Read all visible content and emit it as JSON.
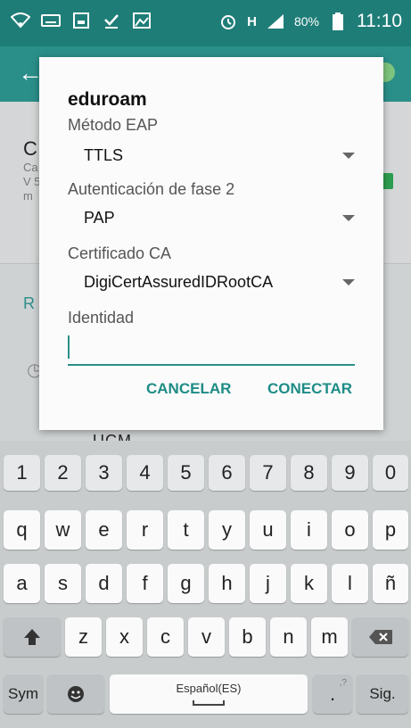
{
  "status_bar": {
    "icons_left": [
      "wifi-icon",
      "keyboard-icon",
      "screenshot-icon",
      "download-done-icon",
      "image-icon"
    ],
    "alarm_icon": "alarm-icon",
    "network_type": "H",
    "battery": "80%",
    "time": "11:10"
  },
  "background": {
    "section_letter": "C",
    "section_text": "Ca y V 5 m",
    "list_header": "R",
    "network_name": "UCM"
  },
  "dialog": {
    "title": "eduroam",
    "eap_label": "Método EAP",
    "eap_value": "TTLS",
    "phase2_label": "Autenticación de fase 2",
    "phase2_value": "PAP",
    "ca_label": "Certificado CA",
    "ca_value": "DigiCertAssuredIDRootCA",
    "identity_label": "Identidad",
    "identity_value": "",
    "cancel_label": "CANCELAR",
    "connect_label": "CONECTAR",
    "accent_color": "#1e8c86"
  },
  "keyboard": {
    "numbers": [
      "1",
      "2",
      "3",
      "4",
      "5",
      "6",
      "7",
      "8",
      "9",
      "0"
    ],
    "row1": [
      "q",
      "w",
      "e",
      "r",
      "t",
      "y",
      "u",
      "i",
      "o",
      "p"
    ],
    "row2": [
      "a",
      "s",
      "d",
      "f",
      "g",
      "h",
      "j",
      "k",
      "l",
      "ñ"
    ],
    "row3": [
      "z",
      "x",
      "c",
      "v",
      "b",
      "n",
      "m"
    ],
    "shift_icon": "shift-arrow-icon",
    "backspace_icon": "backspace-icon",
    "sym_label": "Sym",
    "emoji_icon": "emoji-icon",
    "space_label": "Español(ES)",
    "period_label": ".",
    "period_sub": ",?",
    "next_label": "Sig."
  }
}
